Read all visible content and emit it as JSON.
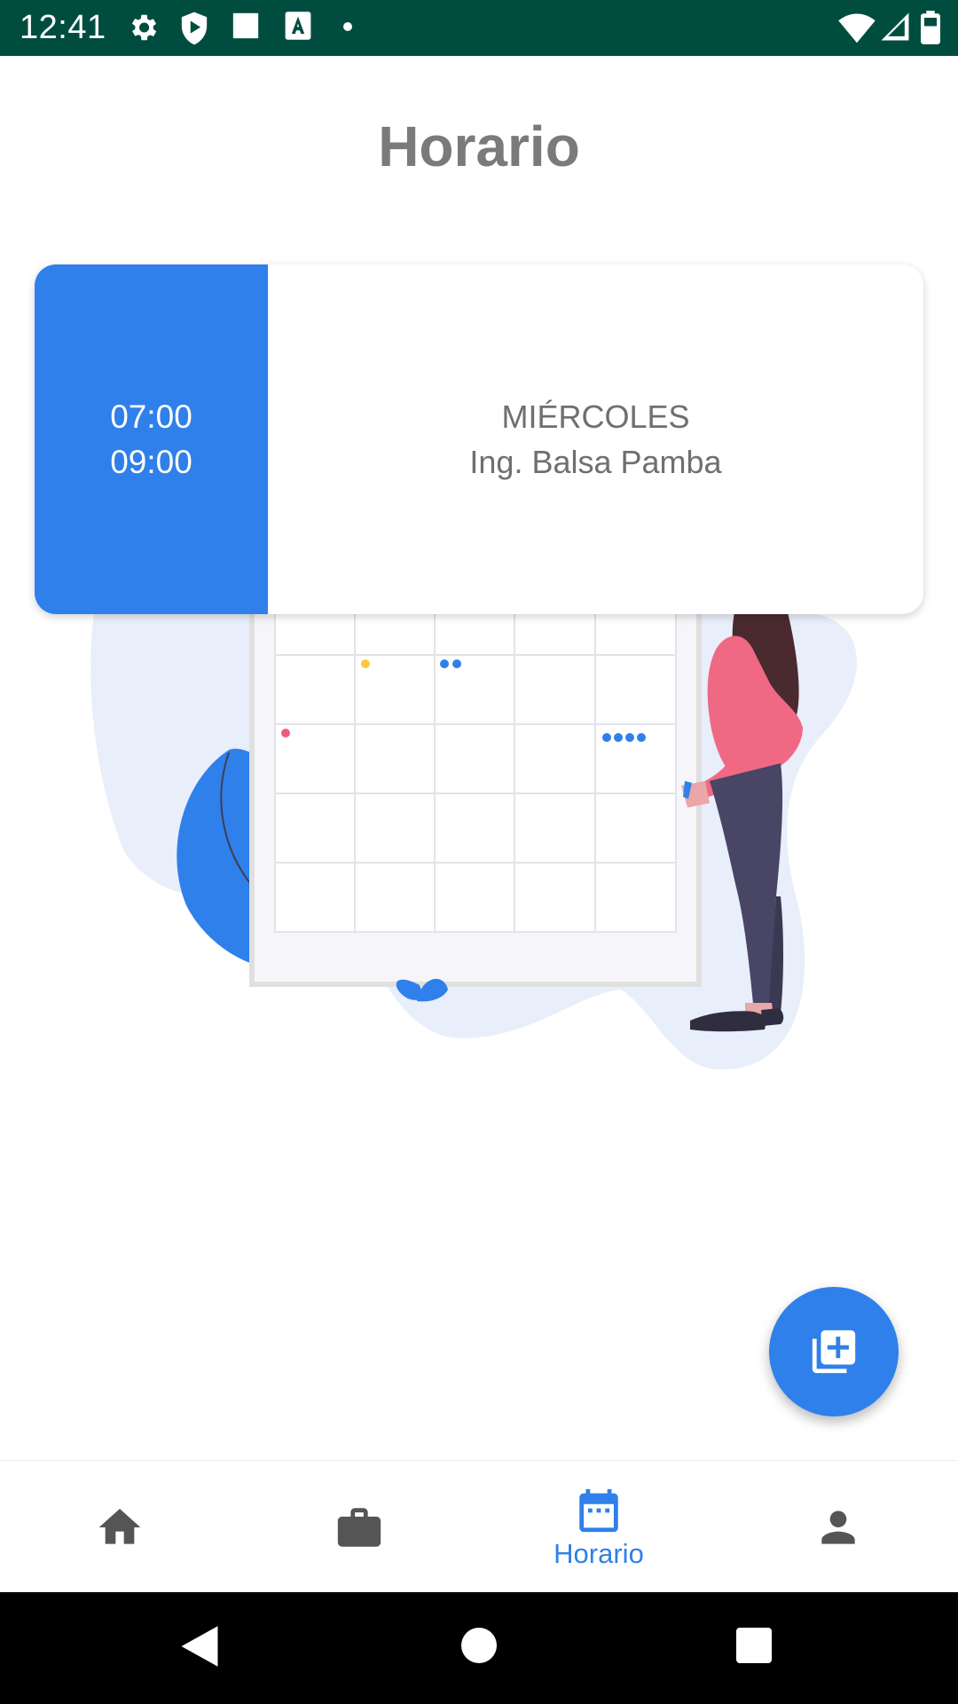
{
  "status_bar": {
    "time": "12:41",
    "icons": [
      "gear-icon",
      "shield-play-icon",
      "square-icon",
      "text-a-icon",
      "dot-icon",
      "wifi-icon",
      "signal-icon",
      "battery-icon"
    ],
    "background": "#004d40"
  },
  "page": {
    "title": "Horario"
  },
  "schedule_card": {
    "start_time": "07:00",
    "end_time": "09:00",
    "day": "MIÉRCOLES",
    "teacher": "Ing. Balsa Pamba",
    "accent_color": "#2f80ea"
  },
  "fab": {
    "icon": "library-add-icon"
  },
  "bottom_nav": {
    "items": [
      {
        "icon": "home-icon",
        "label": ""
      },
      {
        "icon": "briefcase-icon",
        "label": ""
      },
      {
        "icon": "calendar-icon",
        "label": "Horario",
        "active": true
      },
      {
        "icon": "person-icon",
        "label": ""
      }
    ],
    "active_color": "#2f80ea",
    "inactive_color": "#555555"
  },
  "system_nav": {
    "icons": [
      "back-icon",
      "home-circle-icon",
      "recents-icon"
    ]
  }
}
